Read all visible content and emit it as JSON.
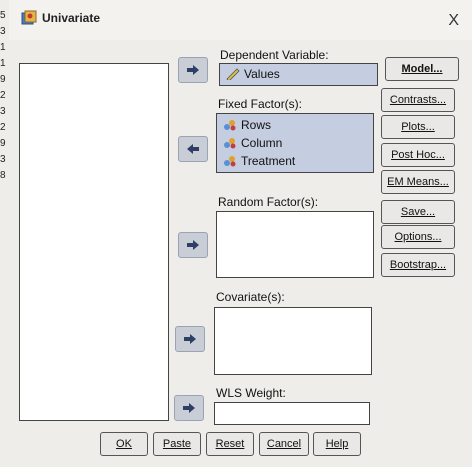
{
  "window": {
    "title": "Univariate",
    "close_glyph": "X"
  },
  "row_numbers": [
    "5",
    "3",
    "1",
    "1",
    "9",
    "2",
    "3",
    "2",
    "9",
    "3",
    "8"
  ],
  "dependent": {
    "label": "Dependent Variable:",
    "value": "Values"
  },
  "fixed": {
    "label": "Fixed Factor(s):",
    "items": [
      "Rows",
      "Column",
      "Treatment"
    ]
  },
  "random": {
    "label": "Random Factor(s):"
  },
  "covariate": {
    "label": "Covariate(s):"
  },
  "wls": {
    "label": "WLS Weight:"
  },
  "side_buttons": [
    "Model...",
    "Contrasts...",
    "Plots...",
    "Post Hoc...",
    "EM Means...",
    "Save...",
    "Options...",
    "Bootstrap..."
  ],
  "bottom_buttons": [
    "OK",
    "Paste",
    "Reset",
    "Cancel",
    "Help"
  ]
}
